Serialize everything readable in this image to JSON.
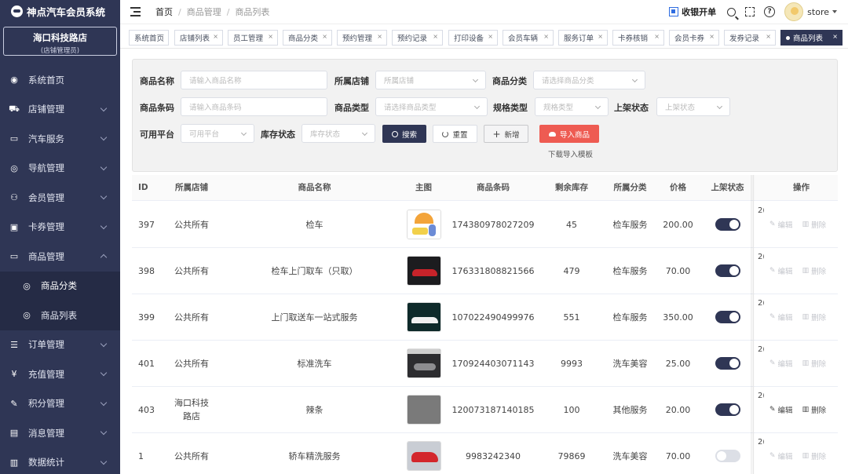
{
  "app": {
    "title": "神点汽车会员系统",
    "store_name": "海口科技路店",
    "store_role": "(店铺管理员)"
  },
  "sidebar": {
    "items": [
      {
        "label": "系统首页",
        "icon": "dashboard-icon"
      },
      {
        "label": "店铺管理",
        "icon": "cart-icon"
      },
      {
        "label": "汽车服务",
        "icon": "briefcase-icon"
      },
      {
        "label": "导航管理",
        "icon": "check-circle-icon"
      },
      {
        "label": "会员管理",
        "icon": "users-icon"
      },
      {
        "label": "卡券管理",
        "icon": "coupon-icon"
      },
      {
        "label": "商品管理",
        "icon": "monitor-icon"
      }
    ],
    "sub_items": [
      {
        "label": "商品分类",
        "icon": "check-circle-icon"
      },
      {
        "label": "商品列表",
        "icon": "check-circle-icon"
      }
    ],
    "items_after": [
      {
        "label": "订单管理",
        "icon": "list-icon"
      },
      {
        "label": "充值管理",
        "icon": "yen-icon"
      },
      {
        "label": "积分管理",
        "icon": "edit-icon"
      },
      {
        "label": "消息管理",
        "icon": "message-icon"
      },
      {
        "label": "数据统计",
        "icon": "bar-chart-icon"
      }
    ]
  },
  "header": {
    "breadcrumb": [
      "首页",
      "商品管理",
      "商品列表"
    ],
    "cashier": "收银开单",
    "user": "store",
    "help_glyph": "?"
  },
  "tabs": [
    {
      "label": "系统首页"
    },
    {
      "label": "店铺列表"
    },
    {
      "label": "员工管理"
    },
    {
      "label": "商品分类"
    },
    {
      "label": "预约管理"
    },
    {
      "label": "预约记录"
    },
    {
      "label": "打印设备"
    },
    {
      "label": "会员车辆"
    },
    {
      "label": "服务订单"
    },
    {
      "label": "卡券核销"
    },
    {
      "label": "会员卡券"
    },
    {
      "label": "发券记录"
    },
    {
      "label": "商品列表"
    }
  ],
  "tab_close": "×",
  "filters": {
    "name_label": "商品名称",
    "name_placeholder": "请输入商品名称",
    "store_label": "所属店铺",
    "store_placeholder": "所属店铺",
    "category_label": "商品分类",
    "category_placeholder": "请选择商品分类",
    "barcode_label": "商品条码",
    "barcode_placeholder": "请输入商品条码",
    "type_label": "商品类型",
    "type_placeholder": "请选择商品类型",
    "spec_label": "规格类型",
    "spec_placeholder": "规格类型",
    "shelf_label": "上架状态",
    "shelf_placeholder": "上架状态",
    "platform_label": "可用平台",
    "platform_placeholder": "可用平台",
    "stock_label": "库存状态",
    "stock_placeholder": "库存状态",
    "search_btn": "搜索",
    "reset_btn": "重置",
    "add_btn": "新增",
    "import_btn": "导入商品",
    "download_template": "下载导入模板"
  },
  "table": {
    "headers": [
      "ID",
      "所属店铺",
      "商品名称",
      "主图",
      "商品条码",
      "剩余库存",
      "所属分类",
      "价格",
      "上架状态",
      "操作"
    ],
    "edit_label": "编辑",
    "delete_label": "删除",
    "truncated_glyph": "2(",
    "rows": [
      {
        "id": "397",
        "store": "公共所有",
        "name": "检车",
        "thumb": "cartoon-car-service",
        "barcode": "174380978027209",
        "stock": "45",
        "category": "检车服务",
        "price": "200.00",
        "on_shelf": true,
        "ops_enabled": false
      },
      {
        "id": "398",
        "store": "公共所有",
        "name": "检车上门取车（只取）",
        "thumb": "red-sports-car",
        "barcode": "176331808821566",
        "stock": "479",
        "category": "检车服务",
        "price": "70.00",
        "on_shelf": true,
        "ops_enabled": false
      },
      {
        "id": "399",
        "store": "公共所有",
        "name": "上门取送车一站式服务",
        "thumb": "white-supercar",
        "barcode": "107022490499976",
        "stock": "551",
        "category": "检车服务",
        "price": "350.00",
        "on_shelf": true,
        "ops_enabled": false
      },
      {
        "id": "401",
        "store": "公共所有",
        "name": "标准洗车",
        "thumb": "garage-car",
        "barcode": "170924403071143",
        "stock": "9993",
        "category": "洗车美容",
        "price": "25.00",
        "on_shelf": true,
        "ops_enabled": false
      },
      {
        "id": "403",
        "store": "海口科技路店",
        "name": "辣条",
        "thumb": "gray-placeholder",
        "barcode": "120073187140185",
        "stock": "100",
        "category": "其他服务",
        "price": "20.00",
        "on_shelf": true,
        "ops_enabled": true
      },
      {
        "id": "1",
        "store": "公共所有",
        "name": "轿车精洗服务",
        "thumb": "red-car-wash",
        "barcode": "9983242340",
        "stock": "79869",
        "category": "洗车美容",
        "price": "70.00",
        "on_shelf": false,
        "ops_enabled": false
      }
    ]
  },
  "colors": {
    "sidebar_bg": "#2f3655",
    "accent": "#2f3655",
    "import_btn": "#ee5b52",
    "switch_off": "#dcdfe6"
  }
}
